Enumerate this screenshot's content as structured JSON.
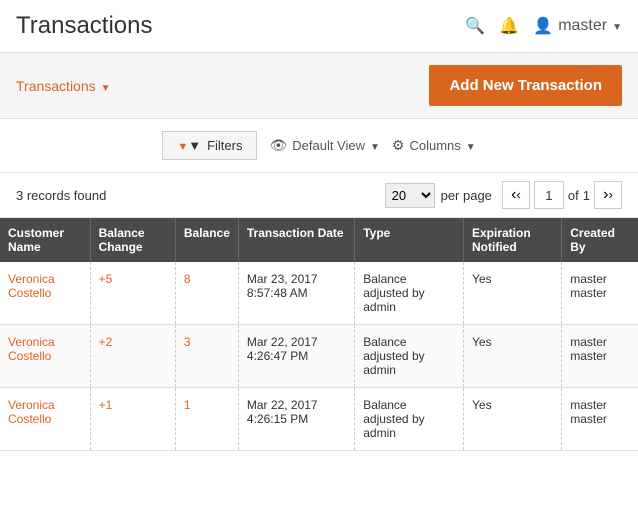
{
  "header": {
    "title": "Transactions",
    "user": "master"
  },
  "toolbar": {
    "dropdown_label": "Transactions",
    "add_button_label": "Add New Transaction"
  },
  "controls": {
    "filter_label": "Filters",
    "view_label": "Default View",
    "columns_label": "Columns"
  },
  "pagination": {
    "records_label": "3 records found",
    "per_page": "20",
    "per_page_label": "per page",
    "current_page": "1",
    "total_pages": "1",
    "of_label": "of"
  },
  "table": {
    "columns": [
      "Customer Name",
      "Balance Change",
      "Balance",
      "Transaction Date",
      "Type",
      "Expiration Notified",
      "Created By"
    ],
    "rows": [
      {
        "customer_name": "Veronica Costello",
        "balance_change": "+5",
        "balance": "8",
        "transaction_date": "Mar 23, 2017 8:57:48 AM",
        "type": "Balance adjusted by admin",
        "expiration_notified": "Yes",
        "created_by": "master master"
      },
      {
        "customer_name": "Veronica Costello",
        "balance_change": "+2",
        "balance": "3",
        "transaction_date": "Mar 22, 2017 4:26:47 PM",
        "type": "Balance adjusted by admin",
        "expiration_notified": "Yes",
        "created_by": "master master"
      },
      {
        "customer_name": "Veronica Costello",
        "balance_change": "+1",
        "balance": "1",
        "transaction_date": "Mar 22, 2017 4:26:15 PM",
        "type": "Balance adjusted by admin",
        "expiration_notified": "Yes",
        "created_by": "master master"
      }
    ]
  }
}
